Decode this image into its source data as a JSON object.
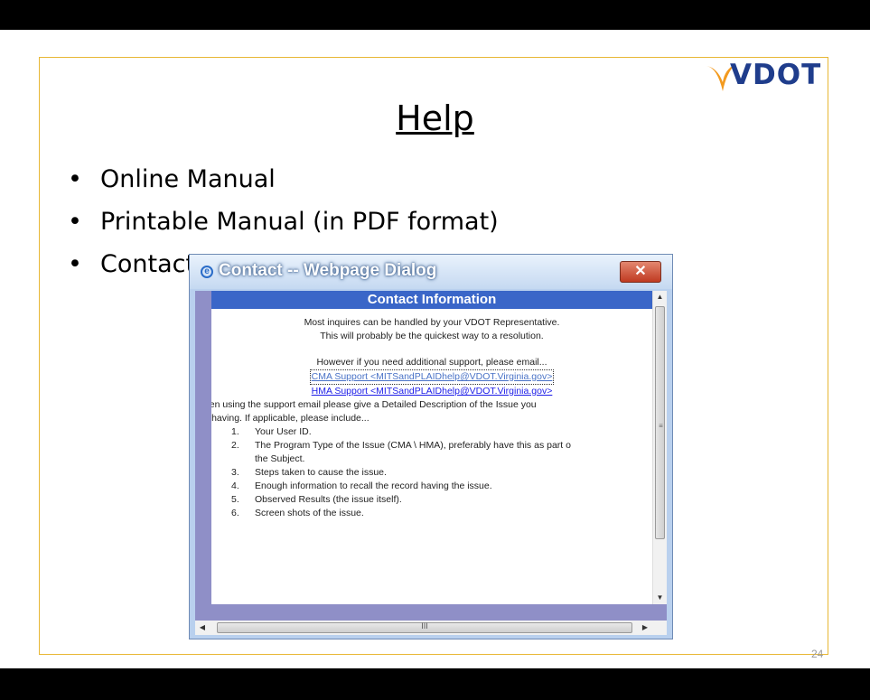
{
  "slide": {
    "logo": "VDOT",
    "title": "Help",
    "bullets": [
      "Online Manual",
      "Printable Manual (in PDF format)",
      "Contact"
    ],
    "bullet_glyph": "•",
    "page_number": "24"
  },
  "dialog": {
    "title": "Contact -- Webpage Dialog",
    "close_label": "✕",
    "header": "Contact Information",
    "intro_line1": "Most inquires can be handled by your VDOT Representative.",
    "intro_line2": "This will probably be the quickest way to a resolution.",
    "email_prompt": "However if you need additional support, please email...",
    "links": [
      "CMA Support <MITSandPLAIDhelp@VDOT.Virginia.gov>",
      "HMA Support <MITSandPLAIDhelp@VDOT.Virginia.gov>"
    ],
    "desc_line1": "When using the support email please give a Detailed Description of the Issue you",
    "desc_line2": "are having. If applicable, please include...",
    "steps": [
      {
        "n": "1.",
        "text": "Your User ID."
      },
      {
        "n": "2.",
        "text": "The Program Type of the Issue (CMA \\ HMA), preferably have this as part o"
      },
      {
        "n": "",
        "text": "the Subject."
      },
      {
        "n": "3.",
        "text": "Steps taken to cause the issue."
      },
      {
        "n": "4.",
        "text": "Enough information to recall the record having the issue."
      },
      {
        "n": "5.",
        "text": "Observed Results (the issue itself)."
      },
      {
        "n": "6.",
        "text": "Screen shots of the issue."
      }
    ],
    "scroll_grip_v": "≡",
    "scroll_grip_h": "III"
  },
  "colors": {
    "frame_border": "#e8b735",
    "logo_blue": "#1f3d8c",
    "logo_orange": "#f39a1e",
    "header_bar": "#3a66c8",
    "close_button": "#c03a21"
  }
}
